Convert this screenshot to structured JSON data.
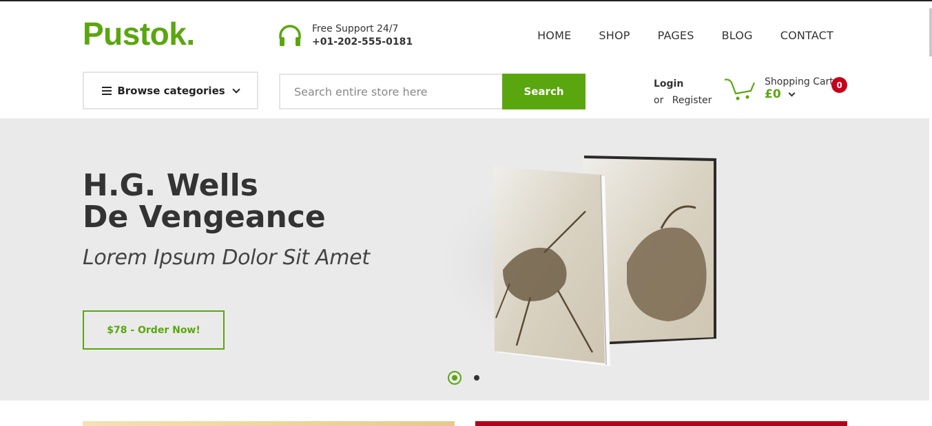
{
  "header": {
    "logo": "Pustok.",
    "support": {
      "label": "Free Support 24/7",
      "phone": "+01-202-555-0181",
      "icon": "headphones-icon"
    },
    "nav": [
      "HOME",
      "SHOP",
      "PAGES",
      "BLOG",
      "CONTACT"
    ]
  },
  "toolbar": {
    "browse_label": "Browse categories",
    "search_placeholder": "Search entire store here",
    "search_button": "Search",
    "login": "Login",
    "or": "or",
    "register": "Register",
    "cart_label": "Shopping Cart",
    "cart_total": "£0",
    "cart_count": "0"
  },
  "hero": {
    "title_line1": "H.G. Wells",
    "title_line2": "De Vengeance",
    "subtitle": "Lorem Ipsum Dolor Sit Amet",
    "button": "$78 - Order Now!",
    "slides": 2,
    "active_slide": 1
  },
  "colors": {
    "accent": "#5aa60f",
    "badge": "#c7001a",
    "hero_bg": "#eaeaea"
  }
}
